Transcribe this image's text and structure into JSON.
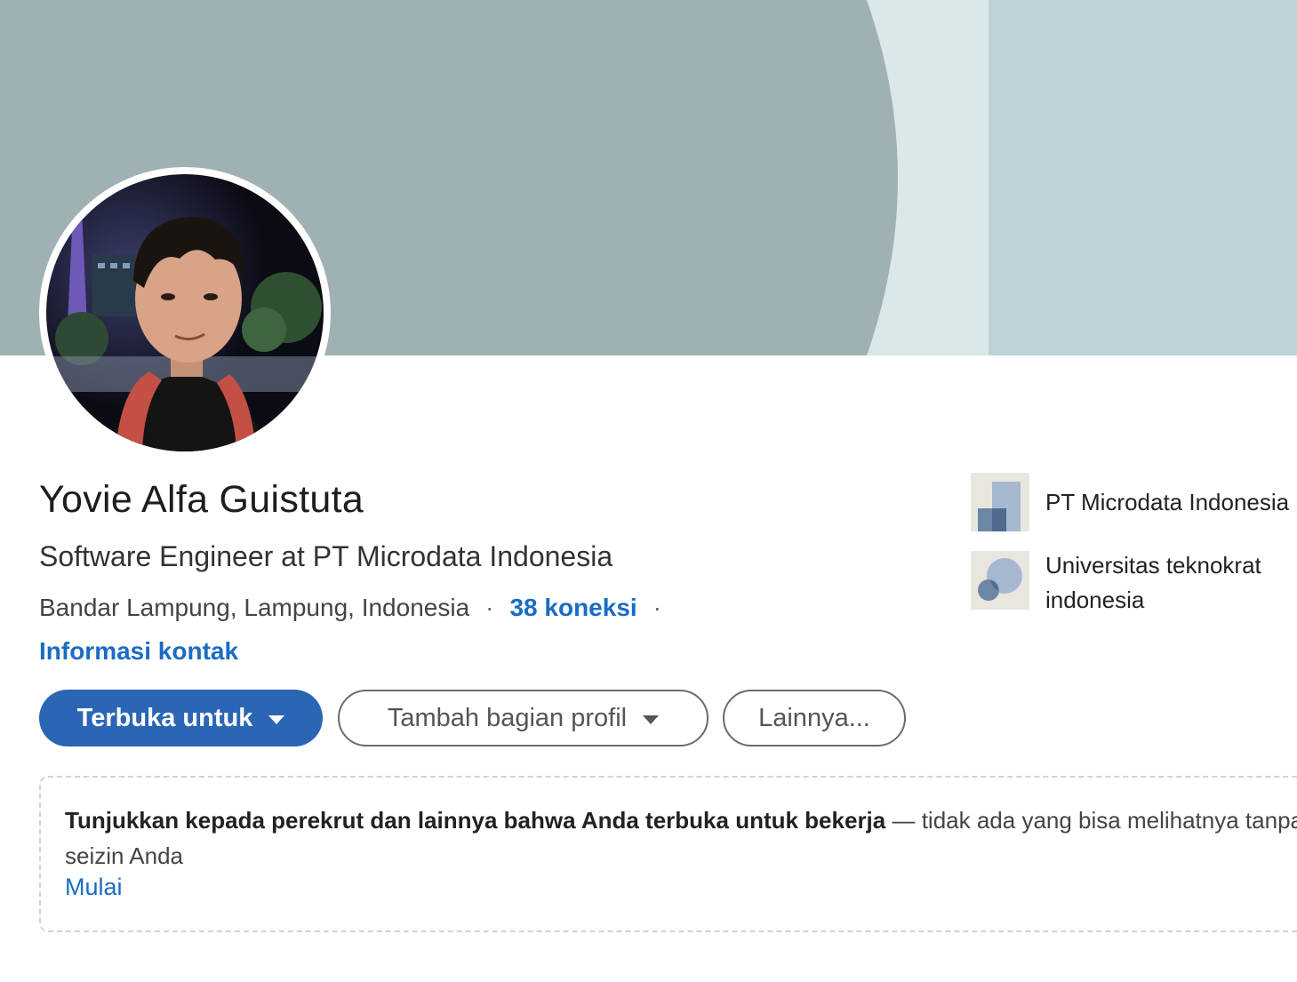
{
  "profile": {
    "name": "Yovie Alfa Guistuta",
    "headline": "Software Engineer at PT Microdata Indonesia",
    "location": "Bandar Lampung, Lampung, Indonesia",
    "separator": "·",
    "connections": "38 koneksi",
    "contact_info": "Informasi kontak"
  },
  "actions": {
    "open_to": "Terbuka untuk",
    "add_section": "Tambah bagian profil",
    "more": "Lainnya..."
  },
  "orgs": [
    {
      "name": "PT Microdata Indonesia",
      "icon": "company-logo-icon"
    },
    {
      "name": "Universitas teknokrat indonesia",
      "icon": "school-logo-icon"
    }
  ],
  "open_to_work_card": {
    "bold_text": "Tunjukkan kepada perekrut dan lainnya bahwa Anda terbuka untuk bekerja",
    "rest_text": " — tidak ada yang bisa melihatnya tanpa seizin Anda",
    "start": "Mulai"
  },
  "colors": {
    "banner_main": "#a0b1b4",
    "banner_light": "#dbe8e9",
    "banner_right": "#bdd3d5",
    "primary": "#2b66b4",
    "link": "#1a6cc4"
  }
}
